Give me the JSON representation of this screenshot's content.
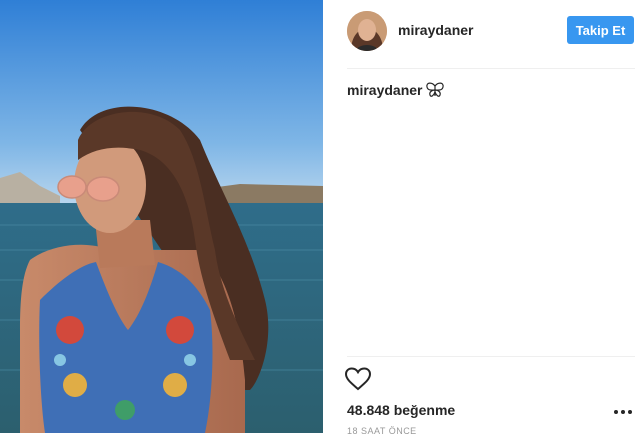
{
  "post": {
    "photo_icon": "selfie-photo",
    "author": {
      "username": "miraydaner",
      "avatar_icon": "avatar"
    },
    "follow_label": "Takip Et",
    "caption": {
      "author": "miraydaner",
      "emoji_icon": "butterfly-icon"
    },
    "likes": "48.848 beğenme",
    "timestamp": "18 SAAT ÖNCE",
    "colors": {
      "follow_button": "#3897f0",
      "text": "#262626",
      "divider": "#efefef"
    }
  }
}
